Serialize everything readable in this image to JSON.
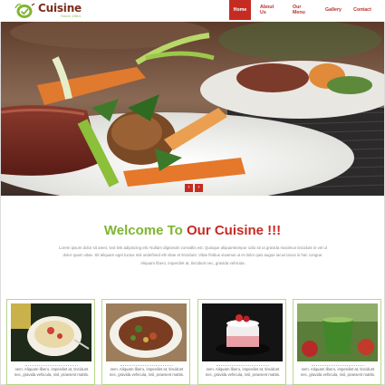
{
  "brand": {
    "title": "Cuisine",
    "tagline": "Since 1964",
    "colors": {
      "green": "#7fb531",
      "red": "#c62b22",
      "brown": "#7a2f1c"
    }
  },
  "nav": {
    "items": [
      {
        "label": "Home",
        "active": true
      },
      {
        "label": "About Us",
        "active": false
      },
      {
        "label": "Our Menu",
        "active": false
      },
      {
        "label": "Gallery",
        "active": false
      },
      {
        "label": "Contact",
        "active": false
      }
    ]
  },
  "hero": {
    "icon": "plated-steak-photo",
    "prev_label": "‹",
    "next_label": "›"
  },
  "welcome": {
    "title_part1": "Welcome To ",
    "title_part2": "Our Cuisine !!!",
    "body": "Lorem ipsum dolor sit amet, test link adipiscing elit. Nullam dignissim convallis est. Quisque aliquamtempor odio sit ut gravida maximus tincidunt in vel ut dolor quam vitae. Sit aliquam eget luctus nisl undefined elit vitae et tincidunt. Vitae finibus vivamus ut et dolor quis augue iacus lacus in hac congue. Aliquam libero, imperdiet at, tincidunt nec, gravida vehicula."
  },
  "cards": [
    {
      "icon": "dessert-bowl-photo",
      "text": "sem. Aliquam libero, imperdiet at, tincidunt nec, gravida vehicula, nisl, praesent mattis."
    },
    {
      "icon": "stew-plate-photo",
      "text": "sem. Aliquam libero, imperdiet at, tincidunt nec, gravida vehicula, nisl, praesent mattis."
    },
    {
      "icon": "strawberry-cake-photo",
      "text": "sem. Aliquam libero, imperdiet at, tincidunt nec, gravida vehicula, nisl, praesent mattis."
    },
    {
      "icon": "green-drink-photo",
      "text": "sem. Aliquam libero, imperdiet at, tincidunt nec, gravida vehicula, nisl, praesent mattis."
    }
  ]
}
